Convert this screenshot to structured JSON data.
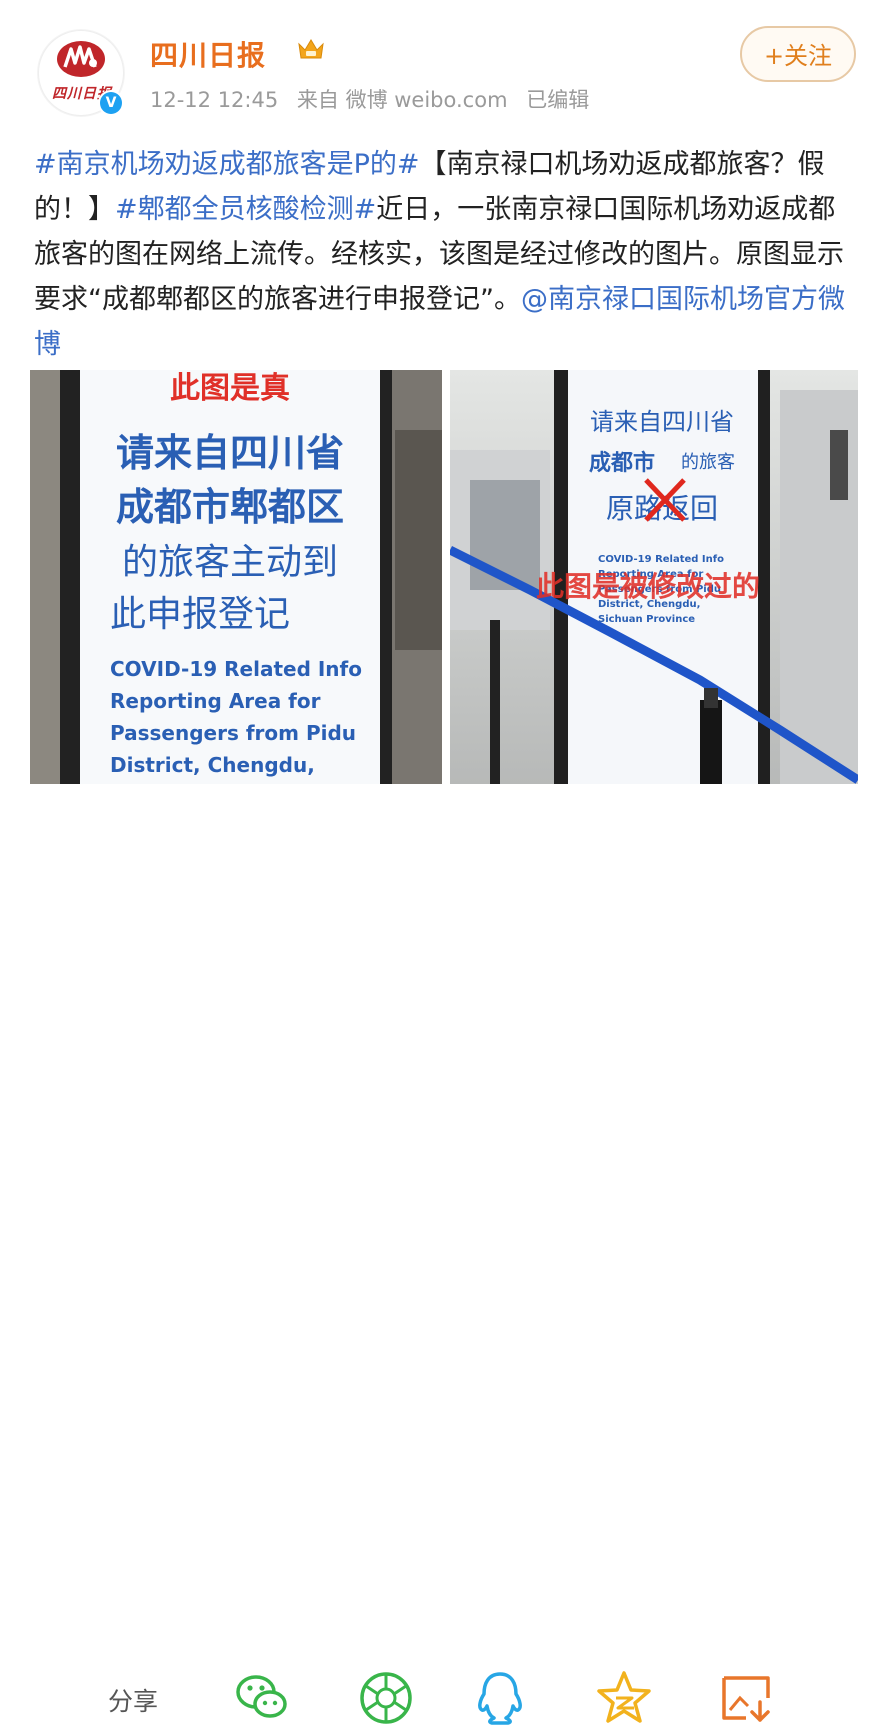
{
  "account": {
    "name": "四川日报",
    "avatar_text": "四川日报",
    "verified_mark": "V"
  },
  "meta": {
    "time": "12-12 12:45",
    "source": "来自 微博 weibo.com",
    "edited": "已编辑"
  },
  "follow_label": "+关注",
  "post": {
    "tag1": "#南京机场劝返成都旅客是P的#",
    "text1": "【南京禄口机场劝返成都旅客？假的！】",
    "tag2": "#郫都全员核酸检测#",
    "text2": "近日，一张南京禄口国际机场劝返成都旅客的图在网络上流传。经核实，该图是经过修改的图片。原图显示要求“成都郫都区的旅客进行申报登记”。",
    "mention": "@南京禄口国际机场官方微博"
  },
  "image_left": {
    "top_caption": "此图是真",
    "line1": "请来自四川省",
    "line2": "成都市郫都区",
    "line3": "的旅客主动到",
    "line4": "此申报登记",
    "en1": "COVID-19 Related Info",
    "en2": "Reporting Area for",
    "en3": "Passengers from Pidu",
    "en4": "District, Chengdu,"
  },
  "image_right": {
    "line1": "请来自四川省",
    "line2a": "成都市",
    "line2b": "的旅客",
    "line3": "原路返回",
    "overlay": "此图是被修改过的",
    "en1": "COVID-19 Related Info",
    "en2": "Reporting Area for",
    "en3": "Passengers from Pidu",
    "en4": "District, Chengdu,",
    "en5": "Sichuan Province"
  },
  "footer": {
    "share_label": "分享",
    "icons": [
      "wechat-icon",
      "moments-icon",
      "qq-icon",
      "qzone-icon",
      "save-image-icon"
    ]
  },
  "colors": {
    "name": "#e86e1e",
    "tag": "#3b6ec7",
    "sign_blue": "#2a5fb4",
    "sign_red": "#e03028",
    "icon_green": "#39b54a",
    "icon_blue": "#27a6e5",
    "icon_yellow": "#f2b21d",
    "icon_orange": "#e8762b"
  }
}
